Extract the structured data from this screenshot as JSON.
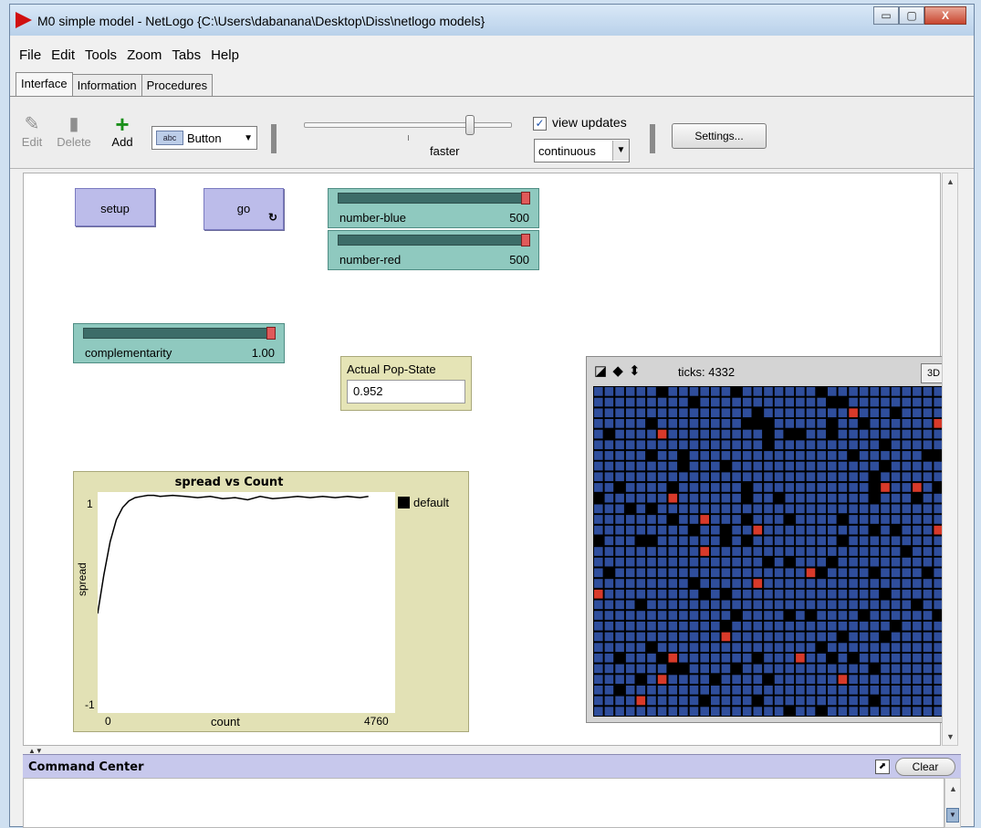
{
  "window": {
    "title": "M0 simple model - NetLogo {C:\\Users\\dabanana\\Desktop\\Diss\\netlogo models}",
    "controls": [
      "▭",
      "▢",
      "X"
    ]
  },
  "menubar": [
    "File",
    "Edit",
    "Tools",
    "Zoom",
    "Tabs",
    "Help"
  ],
  "tabs": [
    "Interface",
    "Information",
    "Procedures"
  ],
  "toolbar": {
    "edit_label": "Edit",
    "delete_label": "Delete",
    "add_label": "Add",
    "widget_type": "Button",
    "widget_icon_text": "abc",
    "speed_label": "faster",
    "speed_level": 0.8,
    "view_updates_label": "view updates",
    "view_updates_checked": true,
    "update_mode": "continuous",
    "settings_label": "Settings..."
  },
  "buttons": {
    "setup_label": "setup",
    "go_label": "go"
  },
  "sliders": {
    "number_blue": {
      "name": "number-blue",
      "value": "500"
    },
    "number_red": {
      "name": "number-red",
      "value": "500"
    },
    "complementarity": {
      "name": "complementarity",
      "value": "1.00"
    }
  },
  "monitor": {
    "label": "Actual Pop-State",
    "value": "0.952"
  },
  "plot": {
    "title": "spread vs Count",
    "ylabel": "spread",
    "xlabel": "count",
    "xmin": "0",
    "xmax": "4760",
    "ymin": "-1",
    "ymax": "1",
    "legend": "default"
  },
  "chart_data": {
    "type": "line",
    "title": "spread vs Count",
    "xlabel": "count",
    "ylabel": "spread",
    "xlim": [
      0,
      4760
    ],
    "ylim": [
      -1,
      1
    ],
    "legend_placement": "right",
    "series": [
      {
        "name": "default",
        "color": "#000000",
        "x": [
          0,
          100,
          200,
          300,
          400,
          500,
          600,
          700,
          800,
          900,
          1000,
          1200,
          1400,
          1600,
          1800,
          2000,
          2200,
          2400,
          2600,
          2800,
          3000,
          3200,
          3400,
          3600,
          3800,
          4000,
          4200,
          4332
        ],
        "y": [
          -0.1,
          0.25,
          0.55,
          0.75,
          0.86,
          0.92,
          0.95,
          0.96,
          0.97,
          0.97,
          0.96,
          0.97,
          0.96,
          0.95,
          0.96,
          0.94,
          0.95,
          0.93,
          0.96,
          0.94,
          0.95,
          0.96,
          0.95,
          0.96,
          0.95,
          0.96,
          0.95,
          0.96
        ]
      }
    ]
  },
  "world": {
    "ticks_label": "ticks: 4332",
    "btn_3d": "3D",
    "nav_icons": "◪ ◆ ⬍",
    "background": "#2f4e9c",
    "patch_border": "#000000",
    "black_color": "#000000",
    "red_color": "#d83a2a"
  },
  "command_center": {
    "title": "Command Center",
    "clear_label": "Clear"
  }
}
